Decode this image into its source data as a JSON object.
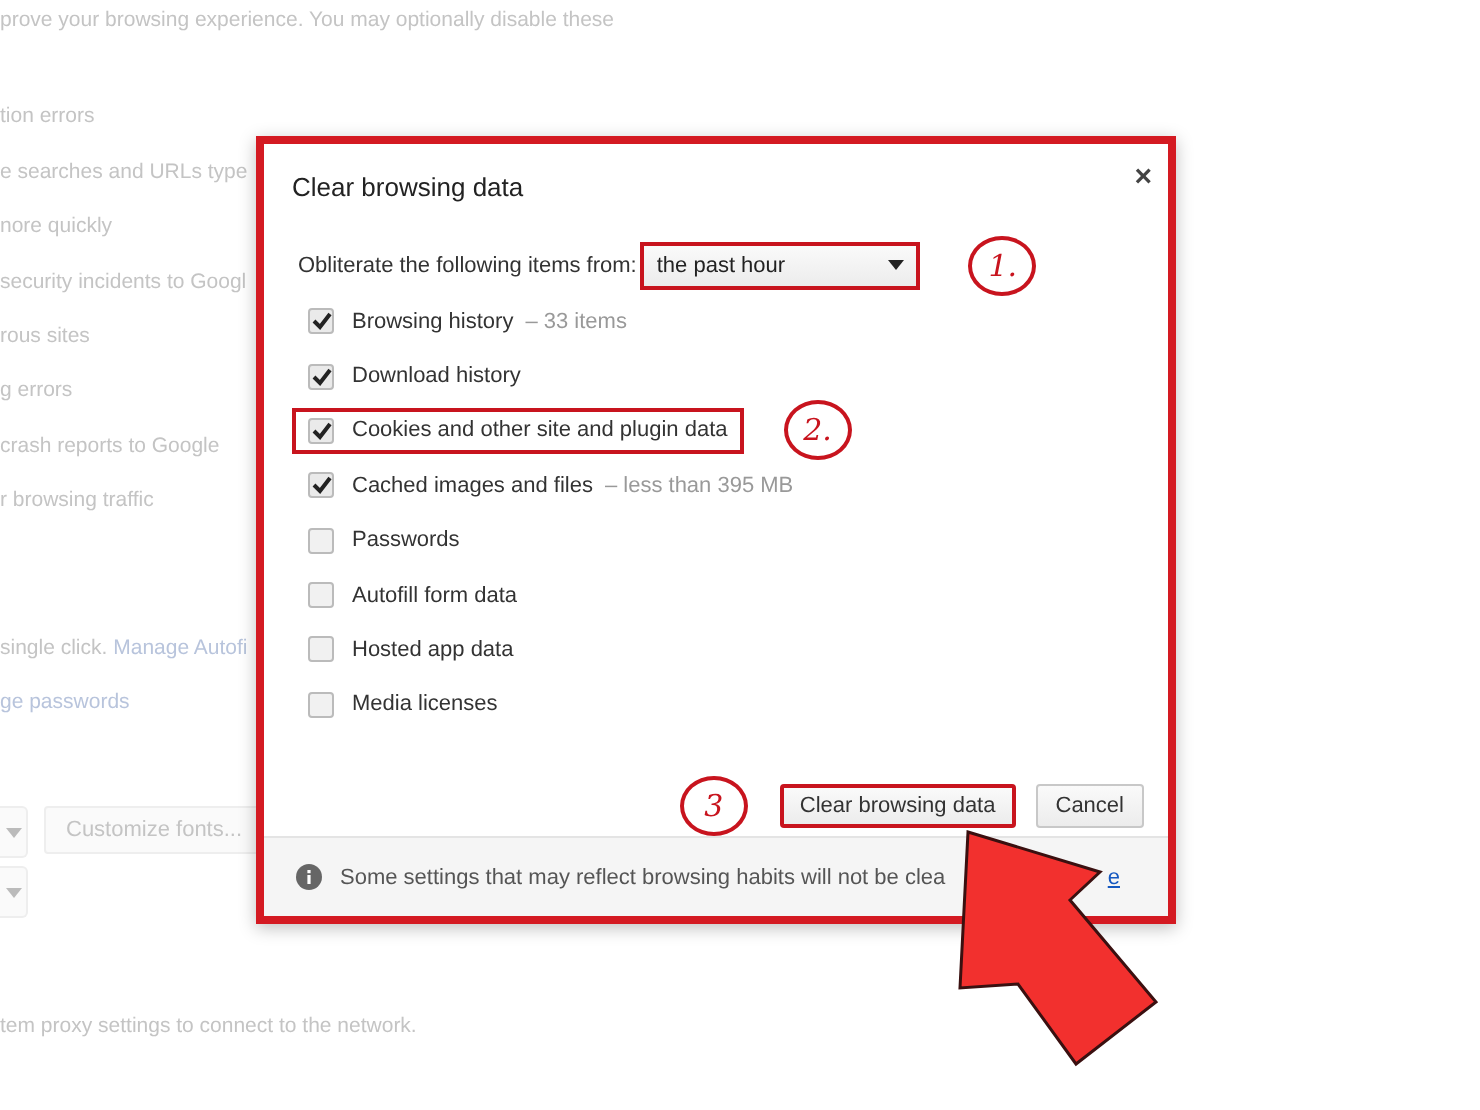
{
  "background": {
    "intro": "prove your browsing experience. You may optionally disable these",
    "privacy_lines": [
      "tion errors",
      "e searches and URLs type",
      "nore quickly",
      "security incidents to Googl",
      "rous sites",
      "g errors",
      "crash reports to Google",
      "r browsing traffic"
    ],
    "autofill": {
      "text": "single click. ",
      "link": "Manage Autofi"
    },
    "passwords_link": "ge passwords",
    "fonts_button": "Customize fonts...",
    "proxy_text": "tem proxy settings to connect to the network."
  },
  "dialog": {
    "title": "Clear browsing data",
    "close": "×",
    "period": {
      "label": "Obliterate the following items from:",
      "value": "the past hour",
      "highlighted": true,
      "marker": "1."
    },
    "items": [
      {
        "label": "Browsing history",
        "detail": "– 33 items",
        "checked": true,
        "highlighted": false
      },
      {
        "label": "Download history",
        "checked": true,
        "highlighted": false
      },
      {
        "label": "Cookies and other site and plugin data",
        "checked": true,
        "highlighted": true,
        "marker": "2."
      },
      {
        "label": "Cached images and files",
        "detail": "– less than 395 MB",
        "checked": true,
        "highlighted": false
      },
      {
        "label": "Passwords",
        "checked": false,
        "highlighted": false
      },
      {
        "label": "Autofill form data",
        "checked": false,
        "highlighted": false
      },
      {
        "label": "Hosted app data",
        "checked": false,
        "highlighted": false
      },
      {
        "label": "Media licenses",
        "checked": false,
        "highlighted": false
      }
    ],
    "buttons": [
      {
        "label": "Clear browsing data",
        "highlighted": true,
        "marker": "3"
      },
      {
        "label": "Cancel",
        "highlighted": false
      }
    ],
    "footer": {
      "text": "Some settings that may reflect browsing habits will not be clea",
      "link": "e"
    }
  }
}
